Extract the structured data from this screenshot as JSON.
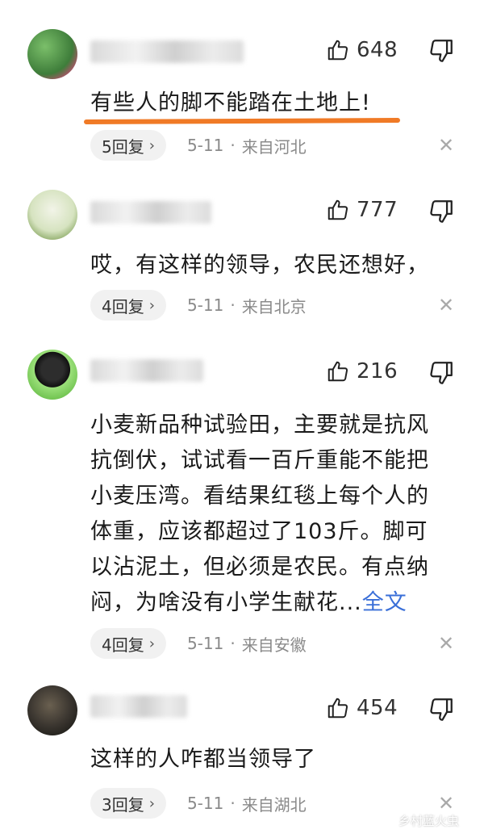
{
  "comments": [
    {
      "likes": "648",
      "text": "有些人的脚不能踏在土地上!",
      "replies": "5回复",
      "date": "5-11",
      "location": "来自河北"
    },
    {
      "likes": "777",
      "text": "哎，有这样的领导，农民还想好，",
      "replies": "4回复",
      "date": "5-11",
      "location": "来自北京"
    },
    {
      "likes": "216",
      "text_lines": [
        "小麦新品种试验田，主要就是抗风",
        "抗倒伏，试试看一百斤重能不能把",
        "小麦压湾。看结果红毯上每个人的",
        "体重，应该都超过了103斤。脚可",
        "以沾泥土，但必须是农民。有点纳",
        "闷，为啥没有小学生献花..."
      ],
      "more": "全文",
      "replies": "4回复",
      "date": "5-11",
      "location": "来自安徽"
    },
    {
      "likes": "454",
      "text": "这样的人咋都当领导了",
      "replies": "3回复",
      "date": "5-11",
      "location": "来自湖北"
    }
  ],
  "meta_separator": "·",
  "close_glyph": "✕",
  "chevron_glyph": "›",
  "watermark": "乡村蓝火虫",
  "colors": {
    "accent_underline": "#f07a26",
    "link": "#3a6fd8",
    "meta_gray": "#8a8a8a"
  }
}
